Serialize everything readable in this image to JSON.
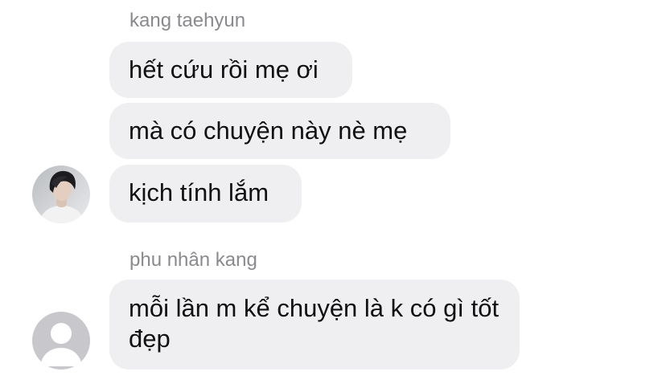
{
  "group1": {
    "sender": "kang taehyun",
    "messages": [
      "hết cứu rồi mẹ ơi",
      "mà có chuyện này nè mẹ",
      "kịch tính lắm"
    ]
  },
  "group2": {
    "sender": "phu nhân kang",
    "messages": [
      "mỗi lần m kể chuyện là k có gì tốt đẹp"
    ]
  },
  "colors": {
    "bubble": "#efeff1",
    "sender_name": "#8a8a8e",
    "text": "#111111",
    "default_avatar_bg": "#c8c8cc"
  },
  "icons": {
    "avatar1": "profile-photo",
    "avatar2": "default-person-avatar-icon"
  }
}
